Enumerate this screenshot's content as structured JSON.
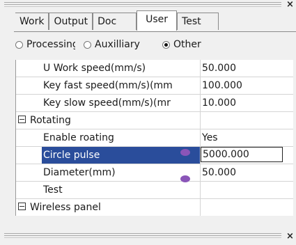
{
  "panel": {
    "close_glyph": "×"
  },
  "tabs": [
    {
      "label": "Work"
    },
    {
      "label": "Output"
    },
    {
      "label": "Doc"
    },
    {
      "label": "User"
    },
    {
      "label": "Test"
    }
  ],
  "active_tab": "User",
  "radios": [
    {
      "label": "Processing",
      "selected": false
    },
    {
      "label": "Auxilliary",
      "selected": false
    },
    {
      "label": "Other",
      "selected": true
    }
  ],
  "grid": {
    "rows": [
      {
        "type": "item",
        "name": "U Work speed(mm/s)",
        "value": "50.000"
      },
      {
        "type": "item",
        "name": "Key fast speed(mm/s)(mm",
        "value": "100.000"
      },
      {
        "type": "item",
        "name": "Key slow speed(mm/s)(mr",
        "value": "10.000"
      },
      {
        "type": "category",
        "name": "Rotating",
        "value": ""
      },
      {
        "type": "item",
        "name": "Enable roating",
        "value": "Yes"
      },
      {
        "type": "item",
        "name": "Circle pulse",
        "value": "5000.000",
        "selected": true,
        "editing": true
      },
      {
        "type": "item",
        "name": "Diameter(mm)",
        "value": "50.000"
      },
      {
        "type": "item",
        "name": "Test",
        "value": ""
      },
      {
        "type": "category",
        "name": "Wireless panel",
        "value": ""
      }
    ]
  },
  "colors": {
    "selection": "#2a4d9b",
    "marker": "#8a55b8",
    "background": "#f0f0f0"
  }
}
